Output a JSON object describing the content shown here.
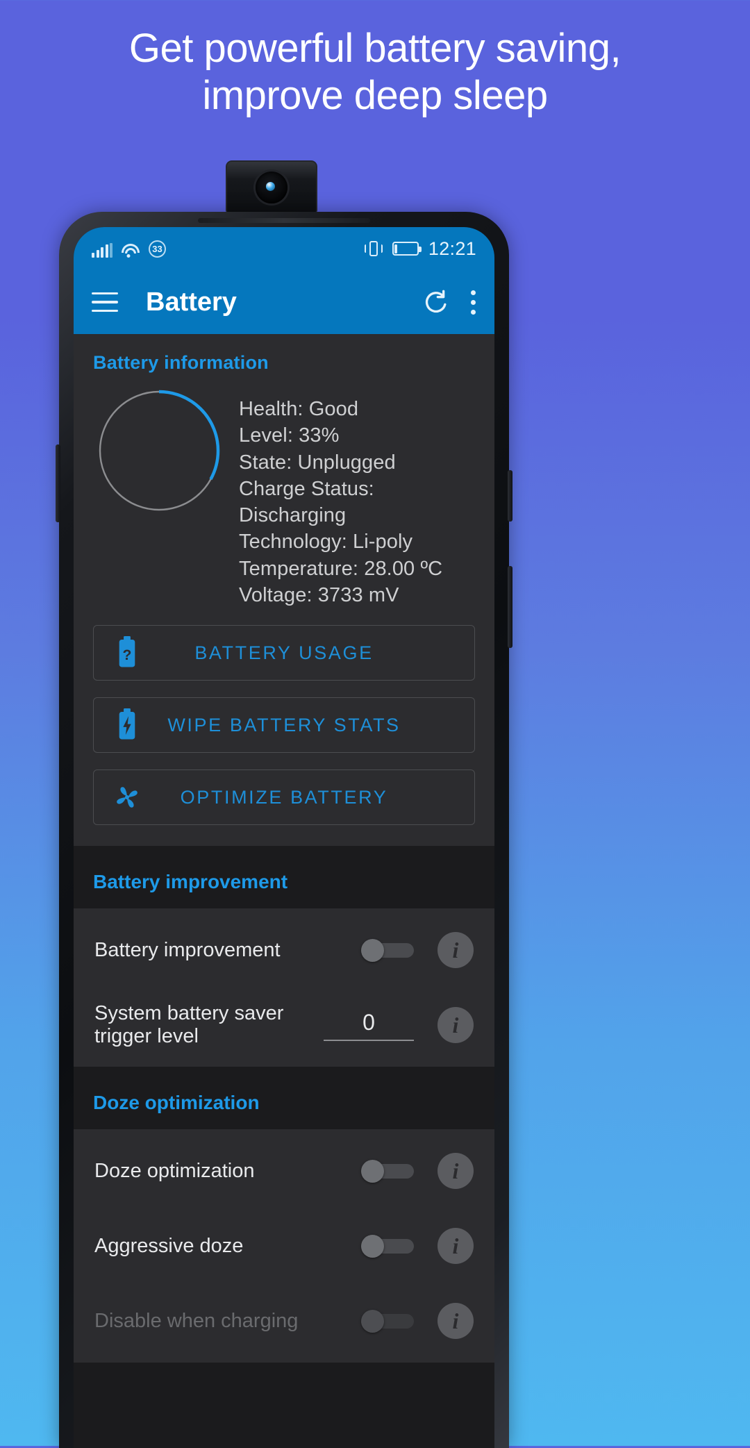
{
  "promo": {
    "headline_line1": "Get powerful battery saving,",
    "headline_line2": "improve deep sleep"
  },
  "statusbar": {
    "signal_icon": "signal-bars-icon",
    "wifi_icon": "wifi-icon",
    "battery_badge": "33",
    "vibrate_icon": "vibrate-icon",
    "battery_icon": "battery-icon",
    "battery_fill_percent": 33,
    "time": "12:21"
  },
  "appbar": {
    "menu_icon": "hamburger-menu-icon",
    "title": "Battery",
    "refresh_icon": "refresh-icon",
    "overflow_icon": "overflow-menu-icon"
  },
  "battery_information": {
    "section_title": "Battery information",
    "gauge_percent": 33,
    "lines": [
      "Health: Good",
      "Level: 33%",
      "State: Unplugged",
      "Charge Status: Discharging",
      "Technology: Li-poly",
      "Temperature: 28.00 ºC",
      "Voltage: 3733 mV"
    ],
    "actions": [
      {
        "label": "BATTERY USAGE",
        "icon": "battery-question-icon"
      },
      {
        "label": "WIPE BATTERY STATS",
        "icon": "battery-bolt-icon"
      },
      {
        "label": "OPTIMIZE BATTERY",
        "icon": "fan-pinwheel-icon"
      }
    ]
  },
  "battery_improvement": {
    "section_title": "Battery improvement",
    "rows": [
      {
        "label": "Battery improvement",
        "control": "switch",
        "value": "off",
        "info_icon": "info-icon"
      },
      {
        "label": "System battery saver trigger level",
        "control": "number",
        "value": "0",
        "info_icon": "info-icon"
      }
    ]
  },
  "doze_optimization": {
    "section_title": "Doze optimization",
    "rows": [
      {
        "label": "Doze optimization",
        "control": "switch",
        "value": "off",
        "disabled": false,
        "info_icon": "info-icon"
      },
      {
        "label": "Aggressive doze",
        "control": "switch",
        "value": "off",
        "disabled": false,
        "info_icon": "info-icon"
      },
      {
        "label": "Disable when charging",
        "control": "switch",
        "value": "off",
        "disabled": true,
        "info_icon": "info-icon"
      }
    ]
  },
  "colors": {
    "promo_bg_top": "#5a63dd",
    "promo_bg_bottom": "#4fb8f0",
    "appbar_blue": "#0577bd",
    "accent_blue": "#1e9ae8",
    "card_bg": "#2c2c2f",
    "screen_bg": "#1b1b1d"
  }
}
